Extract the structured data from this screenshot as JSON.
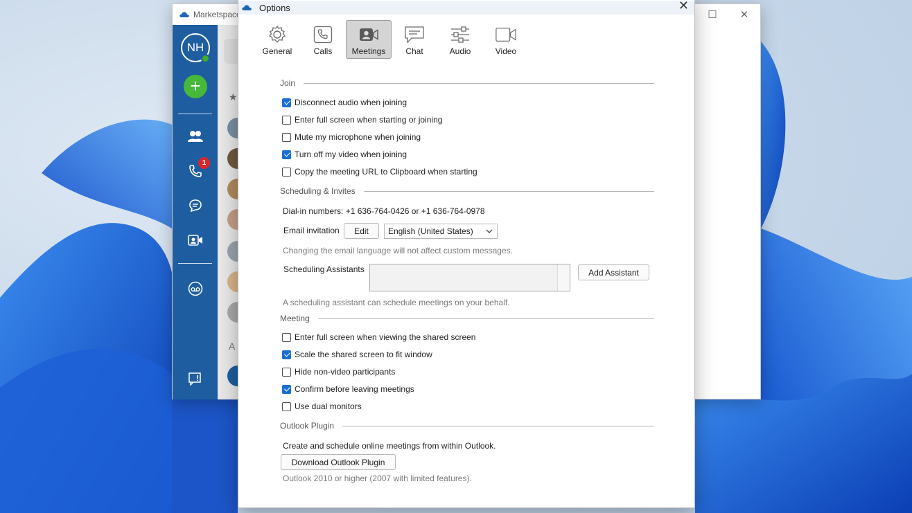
{
  "background_app": {
    "title": "Marketspace",
    "user_initials": "NH",
    "calls_badge": "1",
    "section_letters": [
      "A"
    ],
    "colors": {
      "rail": "#1e5ea0",
      "add": "#46b83a",
      "badge": "#d8262d"
    },
    "rail_icons": [
      "contacts-icon",
      "calls-icon",
      "chat-icon",
      "meetings-icon",
      "voicemail-icon",
      "feedback-icon"
    ]
  },
  "dialog": {
    "title": "Options",
    "tabs": [
      {
        "label": "General",
        "icon": "gear-icon"
      },
      {
        "label": "Calls",
        "icon": "phone-icon"
      },
      {
        "label": "Meetings",
        "icon": "meetings-icon",
        "active": true
      },
      {
        "label": "Chat",
        "icon": "chat-icon"
      },
      {
        "label": "Audio",
        "icon": "sliders-icon"
      },
      {
        "label": "Video",
        "icon": "video-icon"
      }
    ],
    "join": {
      "heading": "Join",
      "options": [
        {
          "label": "Disconnect audio when joining",
          "checked": true
        },
        {
          "label": "Enter full screen when starting or joining",
          "checked": false
        },
        {
          "label": "Mute my microphone when joining",
          "checked": false
        },
        {
          "label": "Turn off my video when joining",
          "checked": true
        },
        {
          "label": "Copy the meeting URL to Clipboard when starting",
          "checked": false
        }
      ]
    },
    "scheduling": {
      "heading": "Scheduling & Invites",
      "dial_in": "Dial-in numbers: +1 636-764-0426 or +1 636-764-0978",
      "email_label": "Email invitation",
      "edit_label": "Edit",
      "language_value": "English (United States)",
      "language_hint": "Changing the email language will not affect custom messages.",
      "assistants_label": "Scheduling Assistants",
      "add_assistant_label": "Add Assistant",
      "assistant_hint": "A scheduling assistant can schedule meetings on your behalf."
    },
    "meeting": {
      "heading": "Meeting",
      "options": [
        {
          "label": "Enter full screen when viewing the shared screen",
          "checked": false
        },
        {
          "label": "Scale the shared screen to fit window",
          "checked": true
        },
        {
          "label": "Hide non-video participants",
          "checked": false
        },
        {
          "label": "Confirm before leaving meetings",
          "checked": true
        },
        {
          "label": "Use dual monitors",
          "checked": false
        }
      ]
    },
    "outlook": {
      "heading": "Outlook Plugin",
      "description": "Create and schedule online meetings from within Outlook.",
      "download_label": "Download Outlook Plugin",
      "requirement": "Outlook 2010 or higher (2007 with limited features)."
    },
    "colors": {
      "accent": "#1a6fd1",
      "active_tab": "#d4d4d4"
    }
  }
}
